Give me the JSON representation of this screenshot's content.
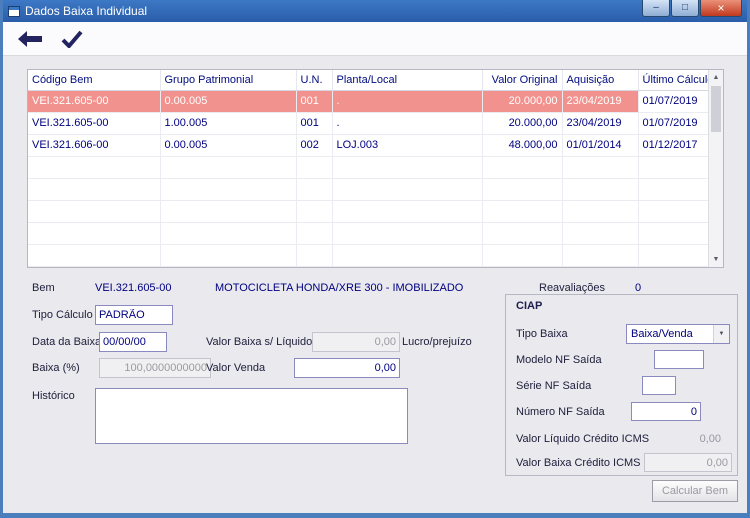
{
  "window": {
    "title": "Dados Baixa Individual"
  },
  "icons": {
    "back": "arrow-left",
    "confirm": "checkmark",
    "minimize": "–",
    "maximize": "□",
    "close": "×",
    "scroll_up": "▲",
    "scroll_down": "▼",
    "combo_arrow": "▼"
  },
  "grid": {
    "headers": [
      "Código Bem",
      "Grupo Patrimonial",
      "U.N.",
      "Planta/Local",
      "Valor Original",
      "Aquisição",
      "Último Cálculo"
    ],
    "rows": [
      {
        "codigo": "VEI.321.605-00",
        "grupo": "0.00.005",
        "un": "001",
        "planta": ".",
        "valor": "20.000,00",
        "aquisicao": "23/04/2019",
        "ultimo": "01/07/2019",
        "selected": true
      },
      {
        "codigo": "VEI.321.605-00",
        "grupo": "1.00.005",
        "un": "001",
        "planta": ".",
        "valor": "20.000,00",
        "aquisicao": "23/04/2019",
        "ultimo": "01/07/2019",
        "selected": false
      },
      {
        "codigo": "VEI.321.606-00",
        "grupo": "0.00.005",
        "un": "002",
        "planta": "LOJ.003",
        "valor": "48.000,00",
        "aquisicao": "01/01/2014",
        "ultimo": "01/12/2017",
        "selected": false
      }
    ]
  },
  "form": {
    "bem_label": "Bem",
    "bem_code": "VEI.321.605-00",
    "bem_desc": "MOTOCICLETA HONDA/XRE 300 - IMOBILIZADO",
    "reavaliacoes_label": "Reavaliações",
    "reavaliacoes_value": "0",
    "tipo_calculo_label": "Tipo Cálculo",
    "tipo_calculo_value": "PADRÃO",
    "data_baixa_label": "Data da Baixa",
    "data_baixa_value": "00/00/00",
    "valor_baixa_label": "Valor Baixa s/ Líquido",
    "valor_baixa_value": "0,00",
    "lucro_label": "Lucro/prejuízo",
    "baixa_pct_label": "Baixa (%)",
    "baixa_pct_value": "100,0000000000",
    "valor_venda_label": "Valor Venda",
    "valor_venda_value": "0,00",
    "historico_label": "Histórico"
  },
  "ciap": {
    "title": "CIAP",
    "tipo_baixa_label": "Tipo Baixa",
    "tipo_baixa_value": "Baixa/Venda",
    "modelo_label": "Modelo NF Saída",
    "modelo_value": "",
    "serie_label": "Série NF Saída",
    "serie_value": "",
    "numero_label": "Número NF Saída",
    "numero_value": "0",
    "valor_liquido_label": "Valor Líquido Crédito ICMS",
    "valor_liquido_value": "0,00",
    "valor_baixa_credito_label": "Valor Baixa Crédito ICMS",
    "valor_baixa_credito_value": "0,00"
  },
  "footer": {
    "calcular_button": "Calcular Bem"
  },
  "colors": {
    "titlebar_blue": "#2f63b0",
    "frame_blue": "#4a7ebc",
    "selected_row": "#f2928e",
    "grid_text_navy": "#000080"
  }
}
